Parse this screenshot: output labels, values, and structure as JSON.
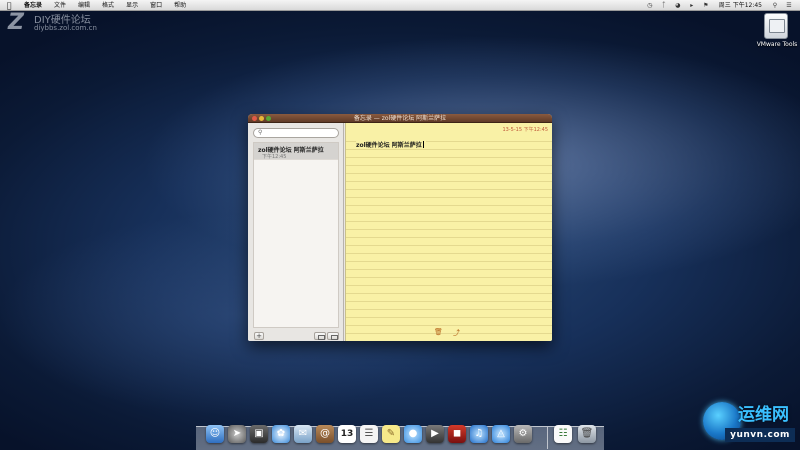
{
  "menubar": {
    "apple_icon": "apple-icon",
    "items": [
      "备忘录",
      "文件",
      "编辑",
      "格式",
      "显示",
      "窗口",
      "帮助"
    ],
    "status_icons": [
      "time-machine-icon",
      "bluetooth-icon",
      "wifi-icon",
      "volume-icon",
      "input-flag-icon"
    ],
    "clock": "周三 下午12:45",
    "spotlight_icon": "spotlight-icon",
    "list_icon": "notification-list-icon"
  },
  "watermark_top": {
    "logo": "Z",
    "name": "DIY硬件论坛",
    "url": "diybbs.zol.com.cn"
  },
  "watermark_bottom": {
    "name": "运维网",
    "url": "yunvn.com"
  },
  "desktop": {
    "icons": [
      {
        "label": "VMware Tools",
        "icon": "drive-icon"
      }
    ]
  },
  "window": {
    "title": "备忘录 — zol硬件论坛 阿斯兰萨拉",
    "sidebar": {
      "search": {
        "placeholder": "",
        "icon": "search-icon"
      },
      "notes": [
        {
          "title": "zol硬件论坛 阿斯兰萨拉",
          "time": "下午12:45",
          "selected": true
        }
      ],
      "add_label": "+"
    },
    "note": {
      "date": "13-5-15 下午12:45",
      "body": "zol硬件论坛 阿斯兰萨拉"
    }
  },
  "dock": {
    "calendar_day": "13",
    "items": [
      "finder-icon",
      "launchpad-icon",
      "mission-control-icon",
      "safari-icon",
      "mail-icon",
      "contacts-icon",
      "calendar-icon",
      "reminders-icon",
      "notes-icon",
      "messages-icon",
      "facetime-icon",
      "photo-booth-icon",
      "itunes-icon",
      "app-store-icon",
      "system-preferences-icon",
      "document-icon",
      "trash-icon"
    ]
  },
  "colors": {
    "titlebar": "#6f4630",
    "paper": "#f9f1a6",
    "date_text": "#c0593a"
  }
}
